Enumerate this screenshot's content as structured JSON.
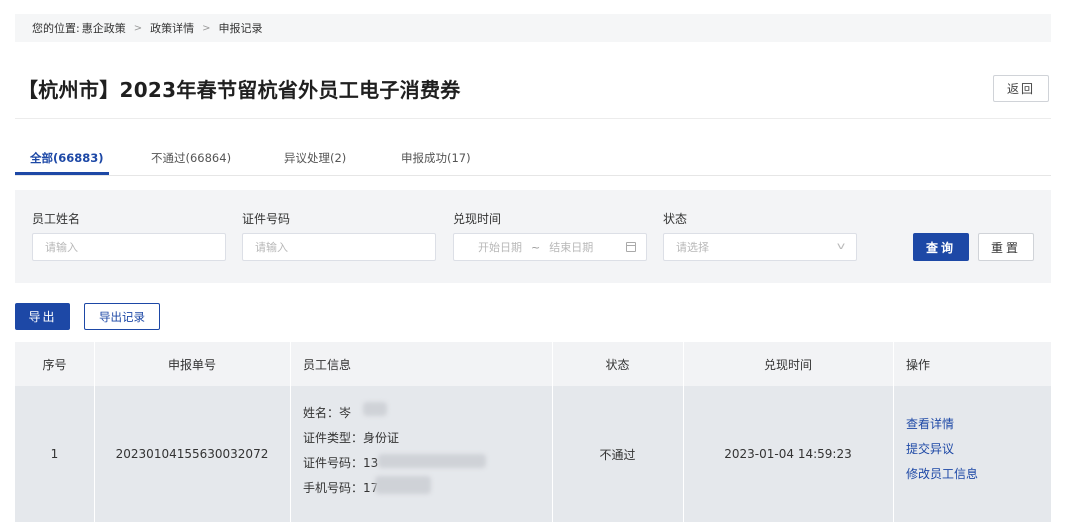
{
  "breadcrumb": {
    "prefix": "您的位置:",
    "items": [
      "惠企政策",
      "政策详情",
      "申报记录"
    ],
    "separator": ">"
  },
  "page": {
    "title": "【杭州市】2023年春节留杭省外员工电子消费券",
    "back_label": "返回"
  },
  "tabs": [
    {
      "label": "全部(66883)",
      "active": true
    },
    {
      "label": "不通过(66864)",
      "active": false
    },
    {
      "label": "异议处理(2)",
      "active": false
    },
    {
      "label": "申报成功(17)",
      "active": false
    }
  ],
  "filters": {
    "name": {
      "label": "员工姓名",
      "placeholder": "请输入"
    },
    "id_number": {
      "label": "证件号码",
      "placeholder": "请输入"
    },
    "redeem_time": {
      "label": "兑现时间",
      "start_placeholder": "开始日期",
      "separator": "~",
      "end_placeholder": "结束日期"
    },
    "status": {
      "label": "状态",
      "placeholder": "请选择"
    },
    "query_label": "查询",
    "reset_label": "重置"
  },
  "actions": {
    "export_label": "导出",
    "export_record_label": "导出记录"
  },
  "table": {
    "columns": [
      "序号",
      "申报单号",
      "员工信息",
      "状态",
      "兑现时间",
      "操作"
    ],
    "rows": [
      {
        "index": "1",
        "order_no": "20230104155630032072",
        "info": {
          "name": "姓名：岑",
          "id_type": "证件类型：身份证",
          "id_number": "证件号码：13",
          "phone": "手机号码：17"
        },
        "status": "不通过",
        "time": "2023-01-04 14:59:23",
        "ops": [
          "查看详情",
          "提交异议",
          "修改员工信息"
        ]
      }
    ]
  },
  "colors": {
    "primary": "#1d48a6",
    "row_bg": "#e5e8ec",
    "header_bg": "#f2f3f5"
  }
}
